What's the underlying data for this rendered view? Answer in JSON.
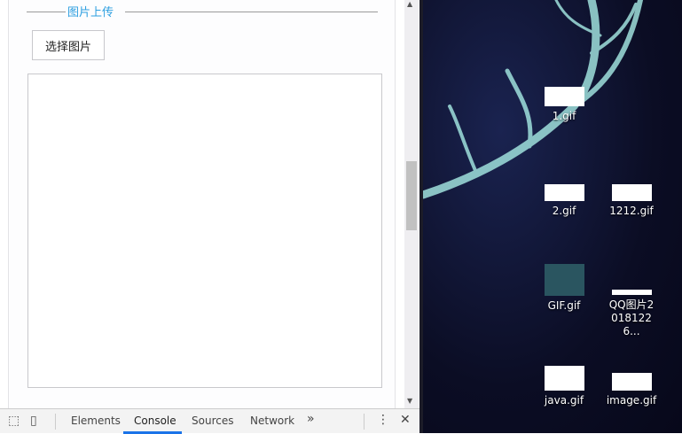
{
  "page": {
    "legend": "图片上传",
    "choose_button": "选择图片"
  },
  "devtools": {
    "tabs": [
      "Elements",
      "Console",
      "Sources",
      "Network"
    ],
    "active_tab": "Console",
    "more": "»",
    "menu": "⋮",
    "close": "✕"
  },
  "desktop": {
    "icons": [
      {
        "label": "1.gif"
      },
      {
        "label": "2.gif"
      },
      {
        "label": "1212.gif"
      },
      {
        "label": "GIF.gif"
      },
      {
        "label": "QQ图片20181226..."
      },
      {
        "label": "java.gif"
      },
      {
        "label": "image.gif"
      }
    ]
  },
  "colors": {
    "accent": "#2d9fe0",
    "desktop_bg": "#0b0d24"
  }
}
